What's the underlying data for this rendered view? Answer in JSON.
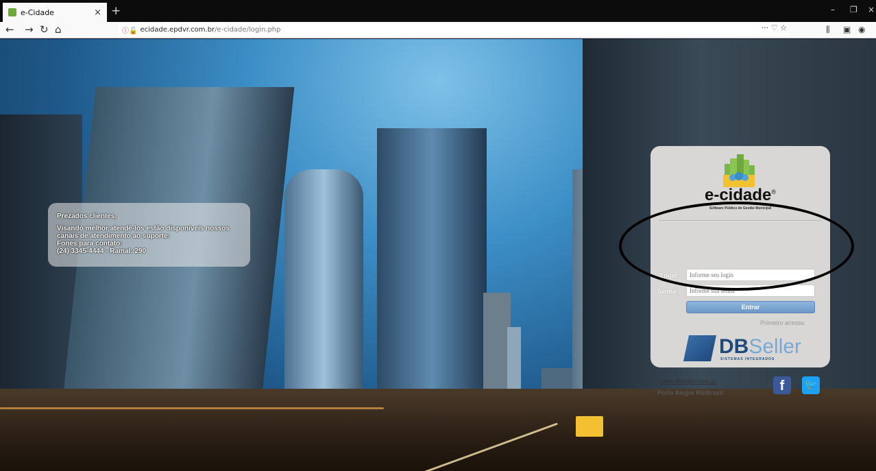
{
  "browser": {
    "tab_title": "e-Cidade",
    "tab_close": "×",
    "new_tab": "+",
    "url_host": "ecidade.epdvr.com.br",
    "url_path": "/e-cidade/login.php",
    "url_actions": "··· ♡ ☆",
    "minimize": "–",
    "maximize": "❐",
    "close": "×"
  },
  "notice": {
    "greeting": "Prezados clientes,",
    "message": "Visando melhor atendê-los estão disponíveis nossos canais de atendimento ao suporte:",
    "phones_label": "Fones para contato:",
    "phone": "(24) 3345-4444 - Ramal: 290"
  },
  "login": {
    "brand": "e-cidade",
    "brand_mark": "®",
    "tagline": "Software Público de Gestão Municipal",
    "login_label": "Login:",
    "login_placeholder": "Informe seu login",
    "password_label": "Senha:",
    "password_placeholder": "Informe sua senha",
    "submit_label": "Entrar",
    "first_access": "Primeiro acesso"
  },
  "footer": {
    "vendor_bold": "DB",
    "vendor_light": "Seller",
    "vendor_sub": "SISTEMAS INTEGRADOS",
    "website": "www.dbseller.com.br",
    "location": "Porto Alegre RS/Brasil",
    "facebook_glyph": "f",
    "twitter_glyph": "🐦"
  },
  "colors": {
    "accent": "#6c98c7",
    "facebook": "#3b5998",
    "twitter": "#1da1f2",
    "panel": "#d8d7d5"
  }
}
